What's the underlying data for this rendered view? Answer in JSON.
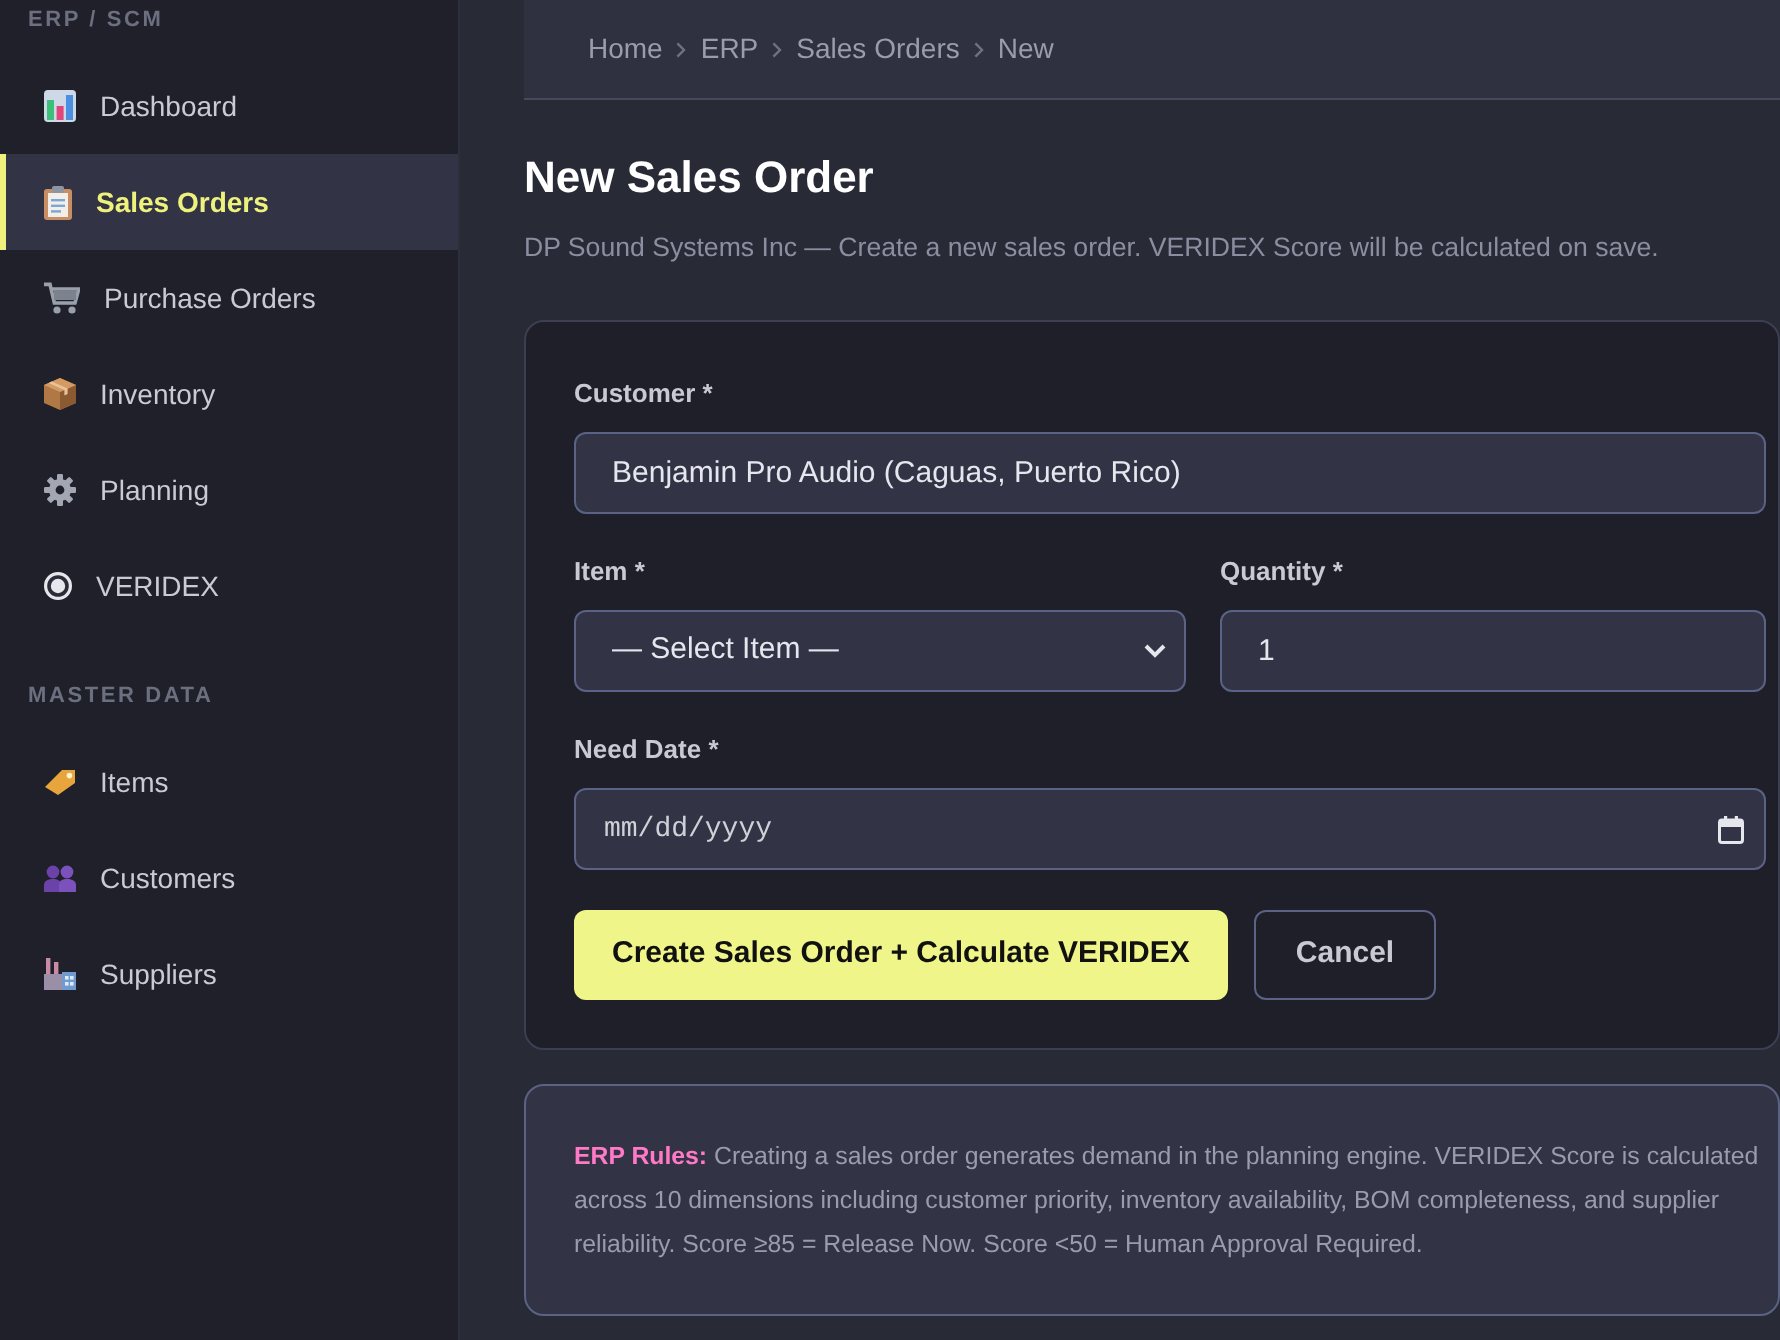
{
  "sidebar": {
    "sections": [
      {
        "heading": "ERP / SCM",
        "items": [
          {
            "label": "Dashboard",
            "selected": false
          },
          {
            "label": "Sales Orders",
            "selected": true
          },
          {
            "label": "Purchase Orders",
            "selected": false
          },
          {
            "label": "Inventory",
            "selected": false
          },
          {
            "label": "Planning",
            "selected": false
          },
          {
            "label": "VERIDEX",
            "selected": false
          }
        ]
      },
      {
        "heading": "MASTER DATA",
        "items": [
          {
            "label": "Items",
            "selected": false
          },
          {
            "label": "Customers",
            "selected": false
          },
          {
            "label": "Suppliers",
            "selected": false
          }
        ]
      }
    ]
  },
  "breadcrumb": [
    "Home",
    "ERP",
    "Sales Orders",
    "New"
  ],
  "page": {
    "title": "New Sales Order",
    "subtitle": "DP Sound Systems Inc — Create a new sales order. VERIDEX Score will be calculated on save."
  },
  "form": {
    "rows": [
      [
        {
          "kind": "text",
          "label": "Customer *",
          "value": "Benjamin Pro Audio (Caguas, Puerto Rico)"
        }
      ],
      [
        {
          "kind": "select",
          "label": "Item *",
          "value": "— Select Item —"
        },
        {
          "kind": "number",
          "label": "Quantity *",
          "value": "1"
        }
      ],
      [
        {
          "kind": "date",
          "label": "Need Date *",
          "placeholder": "mm/dd/yyyy"
        }
      ]
    ],
    "buttons": [
      {
        "kind": "primary",
        "label": "Create Sales Order + Calculate VERIDEX"
      },
      {
        "kind": "secondary",
        "label": "Cancel"
      }
    ]
  },
  "note": {
    "text": "**ERP Rules:** Creating a sales order generates demand in the planning engine. VERIDEX Score is calculated across 10 dimensions including customer priority, inventory availability, BOM completeness, and supplier reliability. Score ≥85 = Release Now. Score <50 = Human Approval Required."
  }
}
